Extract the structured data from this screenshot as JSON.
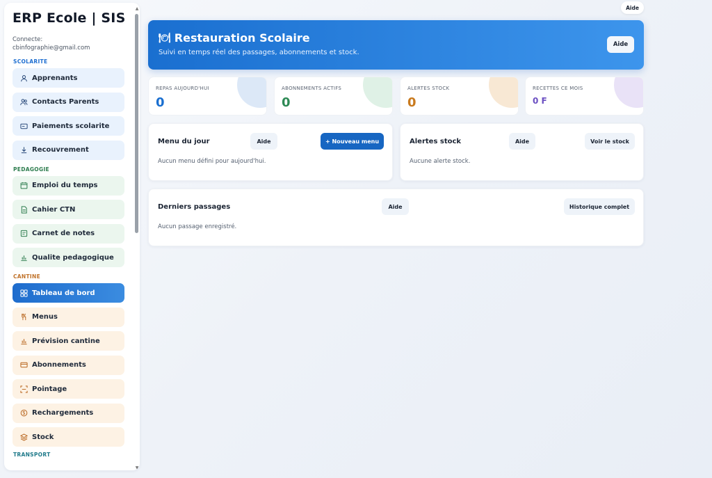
{
  "sidebar": {
    "app_title": "ERP Ecole | SIS",
    "connected_label": "Connecte:",
    "connected_email": "cbinfographie@gmail.com",
    "sections": {
      "scolarite": "SCOLARITE",
      "pedagogie": "PEDAGOGIE",
      "cantine": "CANTINE",
      "transport": "TRANSPORT"
    },
    "scolarite_items": [
      "Apprenants",
      "Contacts Parents",
      "Paiements scolarite",
      "Recouvrement"
    ],
    "pedagogie_items": [
      "Emploi du temps",
      "Cahier CTN",
      "Carnet de notes",
      "Qualite pedagogique"
    ],
    "cantine_items": [
      "Tableau de bord",
      "Menus",
      "Prévision cantine",
      "Abonnements",
      "Pointage",
      "Rechargements",
      "Stock"
    ]
  },
  "top_help": "Aide",
  "banner": {
    "icon": "🍽",
    "title": "Restauration Scolaire",
    "subtitle": "Suivi en temps réel des passages, abonnements et stock.",
    "help": "Aide"
  },
  "kpis": [
    {
      "label": "REPAS AUJOURD'HUI",
      "value": "0",
      "color": "#1a6fd0"
    },
    {
      "label": "ABONNEMENTS ACTIFS",
      "value": "0",
      "color": "#2e8a55"
    },
    {
      "label": "ALERTES STOCK",
      "value": "0",
      "color": "#c97a1e"
    },
    {
      "label": "RECETTES CE MOIS",
      "value": "0 F",
      "color": "#6b4fc2"
    }
  ],
  "menu_card": {
    "title": "Menu du jour",
    "help": "Aide",
    "new_button": "+ Nouveau menu",
    "empty": "Aucun menu défini pour aujourd'hui."
  },
  "stock_card": {
    "title": "Alertes stock",
    "help": "Aide",
    "view_button": "Voir le stock",
    "empty": "Aucune alerte stock."
  },
  "passages_card": {
    "title": "Derniers passages",
    "help": "Aide",
    "history_button": "Historique complet",
    "empty": "Aucun passage enregistré."
  }
}
